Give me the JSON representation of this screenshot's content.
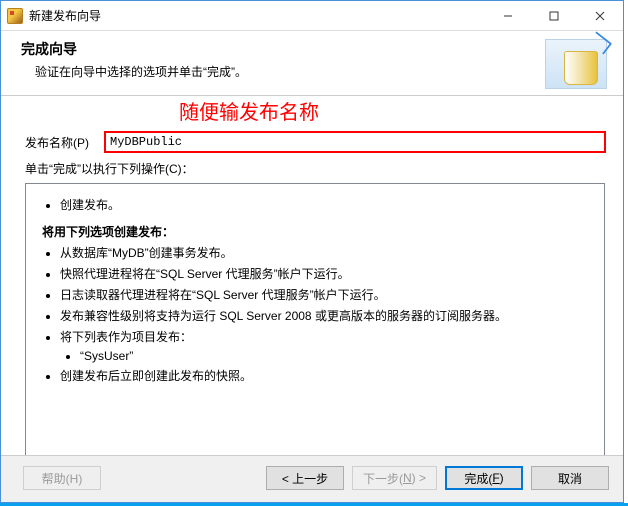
{
  "window": {
    "title": "新建发布向导"
  },
  "header": {
    "title": "完成向导",
    "subtitle": "验证在向导中选择的选项并单击“完成”。"
  },
  "annotation": "随便输发布名称",
  "form": {
    "publish_label": "发布名称(P)",
    "publish_value": "MyDBPublic",
    "ops_intro": "单击“完成”以执行下列操作(C)："
  },
  "ops": {
    "simple": "创建发布。",
    "group_title": "将用下列选项创建发布：",
    "items": [
      "从数据库“MyDB”创建事务发布。",
      "快照代理进程将在“SQL Server 代理服务”帐户下运行。",
      "日志读取器代理进程将在“SQL Server 代理服务”帐户下运行。",
      "发布兼容性级别将支持为运行 SQL Server 2008 或更高版本的服务器的订阅服务器。"
    ],
    "tables_title": "将下列表作为项目发布：",
    "tables": [
      "“SysUser”"
    ],
    "final": "创建发布后立即创建此发布的快照。"
  },
  "buttons": {
    "help": "帮助(H)",
    "back": "< 上一步",
    "next_prefix": "下一步(",
    "next_letter": "N",
    "next_suffix": ") >",
    "finish_prefix": "完成(",
    "finish_letter": "F",
    "finish_suffix": ")",
    "cancel": "取消"
  }
}
